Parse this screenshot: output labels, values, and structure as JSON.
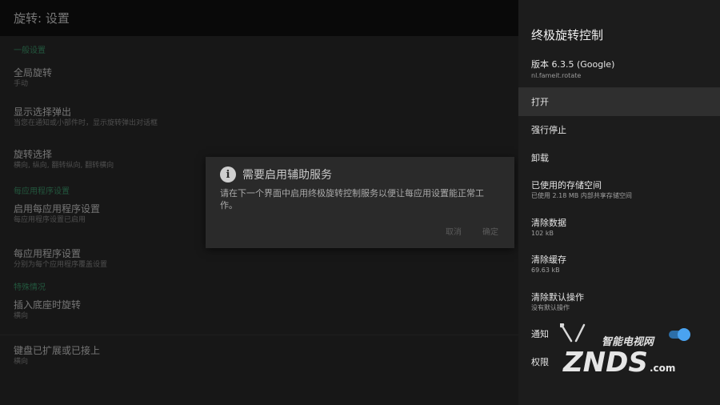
{
  "appbar": {
    "title": "旋转: 设置"
  },
  "settings": {
    "cat_general": "一般设置",
    "global_rotation": {
      "title": "全局旋转",
      "summary": "手动"
    },
    "show_popup": {
      "title": "显示选择弹出",
      "summary": "当您在通知或小部件时，显示旋转弹出对话框"
    },
    "rotation_choice": {
      "title": "旋转选择",
      "summary": "横向, 纵向, 翻转纵向, 翻转横向"
    },
    "cat_per_app": "每应用程序设置",
    "enable_per_app": {
      "title": "启用每应用程序设置",
      "summary": "每应用程序设置已启用"
    },
    "per_app": {
      "title": "每应用程序设置",
      "summary": "分别为每个应用程序覆盖设置"
    },
    "cat_special": "特殊情况",
    "dock_rotation": {
      "title": "插入底座时旋转",
      "summary": "横向"
    },
    "keyboard": {
      "title": "键盘已扩展或已接上",
      "summary": "横向"
    }
  },
  "dialog": {
    "title": "需要启用辅助服务",
    "message": "请在下一个界面中启用终极旋转控制服务以便让每应用设置能正常工作。",
    "cancel": "取消",
    "ok": "确定"
  },
  "panel": {
    "title": "终极旋转控制",
    "version": "版本 6.3.5 (Google)",
    "package": "nl.fameit.rotate",
    "open": "打开",
    "force_stop": "强行停止",
    "uninstall": "卸载",
    "storage": {
      "title": "已使用的存储空间",
      "sub": "已使用 2.18 MB 内部共享存储空间"
    },
    "clear_data": {
      "title": "清除数据",
      "sub": "102 kB"
    },
    "clear_cache": {
      "title": "清除缓存",
      "sub": "69.63 kB"
    },
    "clear_defaults": {
      "title": "清除默认操作",
      "sub": "没有默认操作"
    },
    "notifications": "通知",
    "permissions": "权限"
  },
  "watermark": {
    "brand": "ZNDS",
    "suffix": ".com",
    "tagline": "智能电视网"
  },
  "colors": {
    "accent": "#3f9b6e",
    "toggle": "#4aa3f0",
    "panel_bg": "#1c1c1c"
  }
}
